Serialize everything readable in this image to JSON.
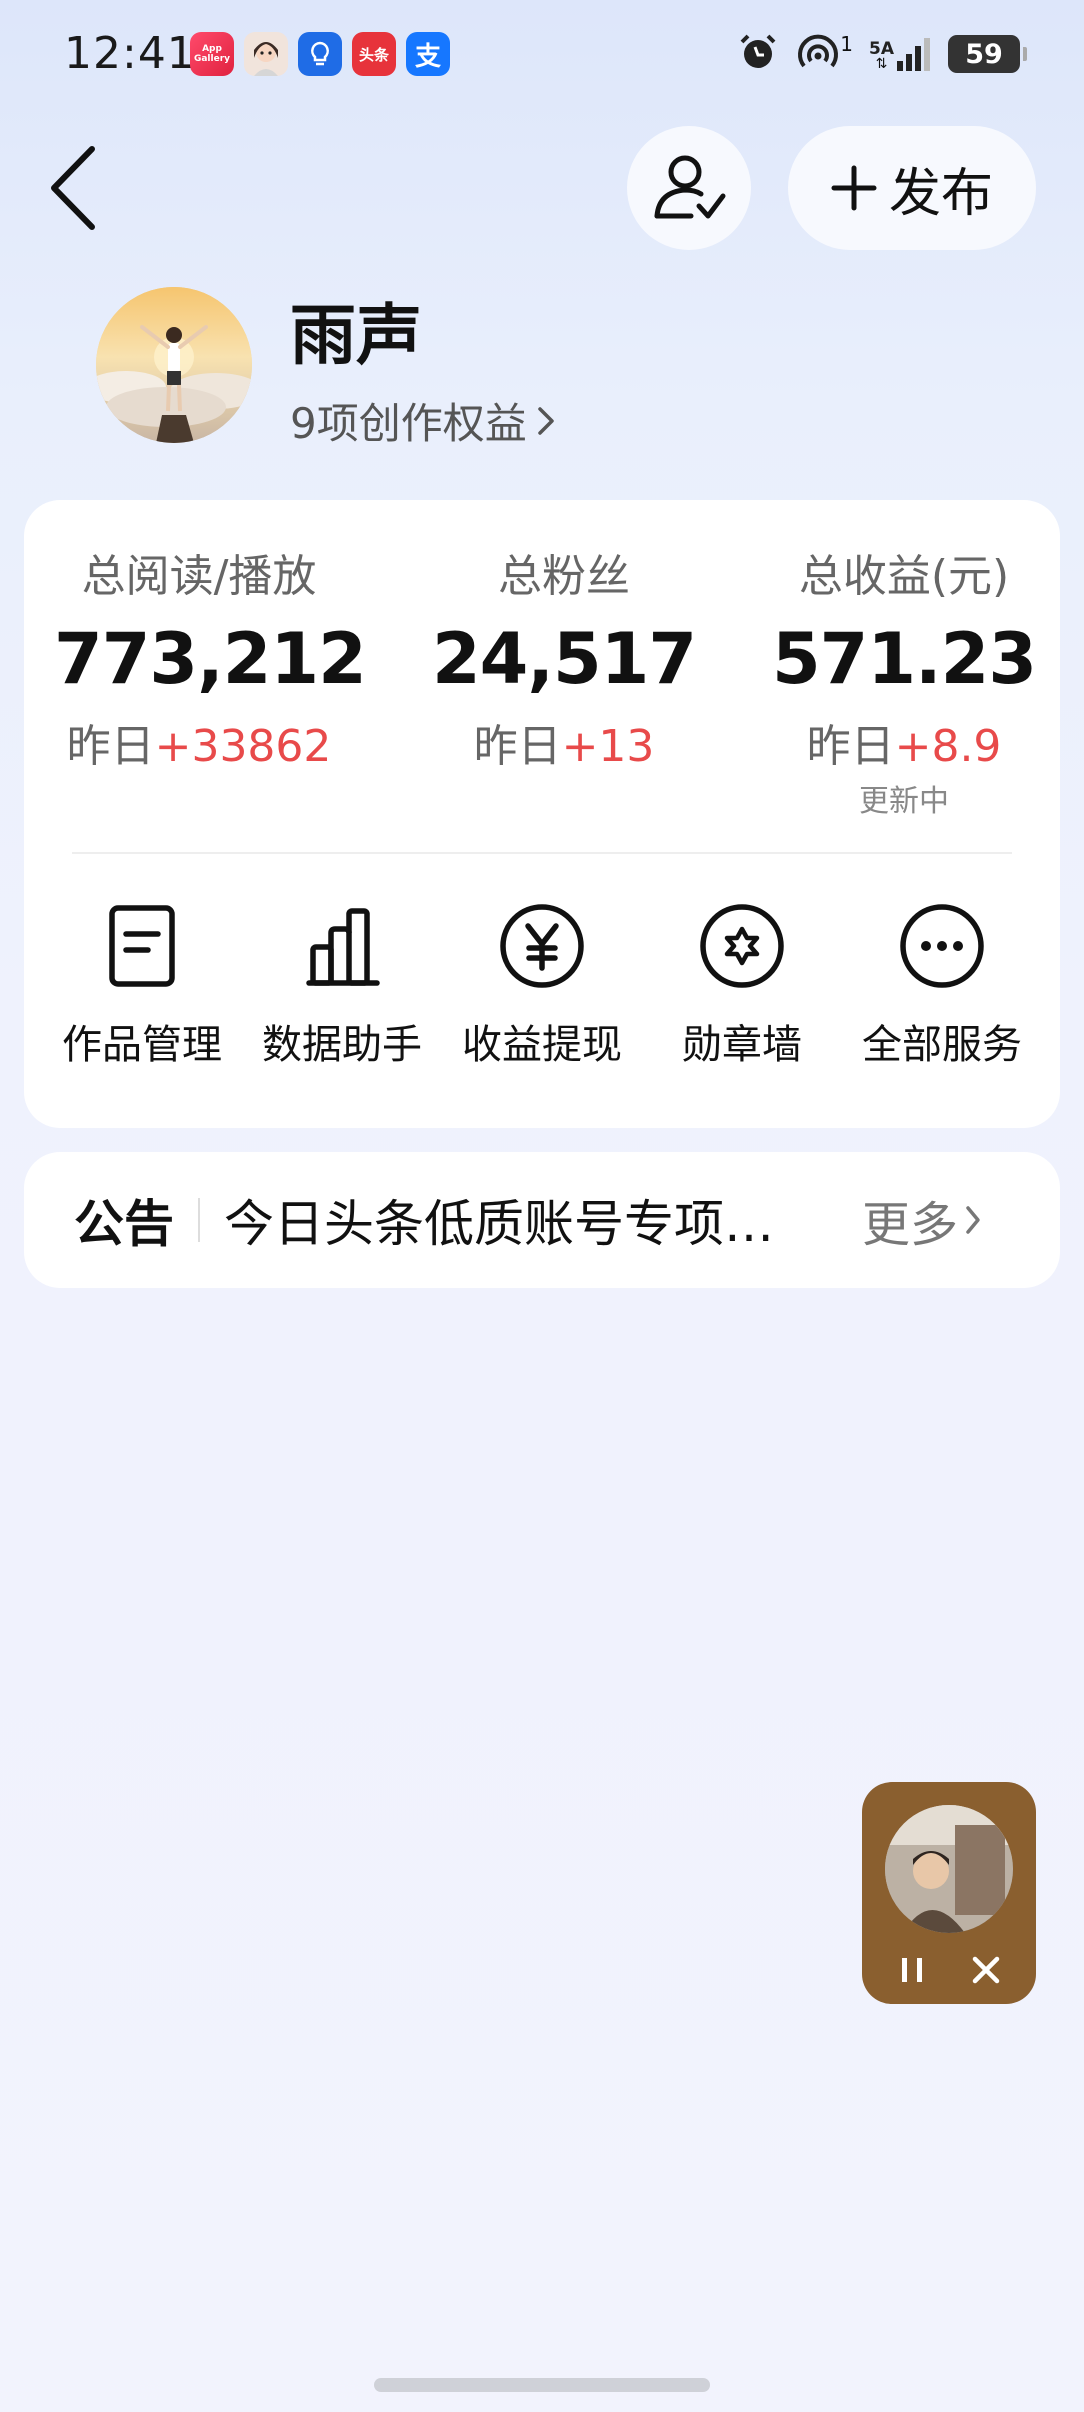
{
  "status_bar": {
    "time": "12:41",
    "battery": "59",
    "network": "5A",
    "hotspot_count": "1",
    "gallery_label": "App Gallery",
    "toutiao_label": "头条",
    "alipay_label": "支"
  },
  "header": {
    "publish_label": "发布"
  },
  "profile": {
    "name": "雨声",
    "rights": "9项创作权益"
  },
  "stats": [
    {
      "label": "总阅读/播放",
      "value": "773,212",
      "delta_prefix": "昨日",
      "delta": "+33862"
    },
    {
      "label": "总粉丝",
      "value": "24,517",
      "delta_prefix": "昨日",
      "delta": "+13"
    },
    {
      "label": "总收益(元)",
      "value": "571.23",
      "delta_prefix": "昨日",
      "delta": "+8.9",
      "sub": "更新中"
    }
  ],
  "services": [
    {
      "label": "作品管理",
      "icon": "document-icon"
    },
    {
      "label": "数据助手",
      "icon": "bar-chart-icon"
    },
    {
      "label": "收益提现",
      "icon": "yuan-coin-icon"
    },
    {
      "label": "勋章墙",
      "icon": "medal-icon"
    },
    {
      "label": "全部服务",
      "icon": "more-icon"
    }
  ],
  "notice": {
    "title": "公告",
    "text": "今日头条低质账号专项…",
    "more": "更多"
  },
  "colors": {
    "delta_up": "#e84a4a",
    "player_bg": "#8a5f2f"
  }
}
